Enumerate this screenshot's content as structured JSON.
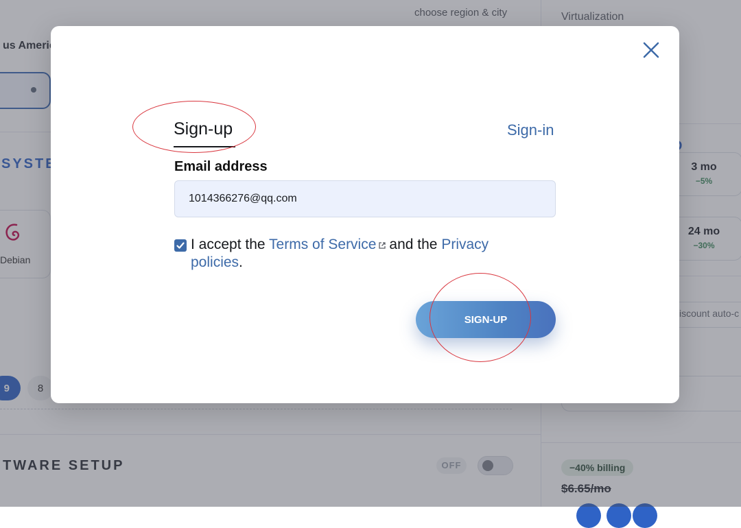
{
  "background": {
    "region_hint": "choose region & city",
    "location_text": "us Americ",
    "os_section_title": "SYSTE",
    "os_option": "Debian",
    "number_options": [
      "9",
      "8"
    ],
    "software_section_title": "TWARE SETUP",
    "software_toggle_label": "OFF",
    "virtualization_label": "Virtualization",
    "period_section_title": "D",
    "periods": [
      {
        "name": "3 mo",
        "discount": "−5%"
      },
      {
        "name": "24 mo",
        "discount": "−30%"
      }
    ],
    "discount_auto_text": "iscount auto-c",
    "billing_badge": "−40% billing",
    "old_price": "$6.65/mo"
  },
  "modal": {
    "tabs": {
      "signup": "Sign-up",
      "signin": "Sign-in"
    },
    "email_label": "Email address",
    "email_value": "1014366276@qq.com",
    "checkbox_checked": true,
    "terms": {
      "prefix": "I accept the ",
      "tos_link": "Terms of Service",
      "middle": "and the ",
      "privacy_link_1": "Privacy",
      "privacy_link_2": "policies",
      "suffix": "."
    },
    "submit_label": "SIGN-UP"
  },
  "colors": {
    "accent": "#3d6aa8",
    "annotation": "#d9363e",
    "button_start": "#6aa3d8",
    "button_end": "#4a72bd"
  },
  "icons": {
    "close": "close-icon",
    "external_link": "external-link-icon",
    "os_logo": "debian-logo-icon",
    "check": "checkmark-icon"
  }
}
